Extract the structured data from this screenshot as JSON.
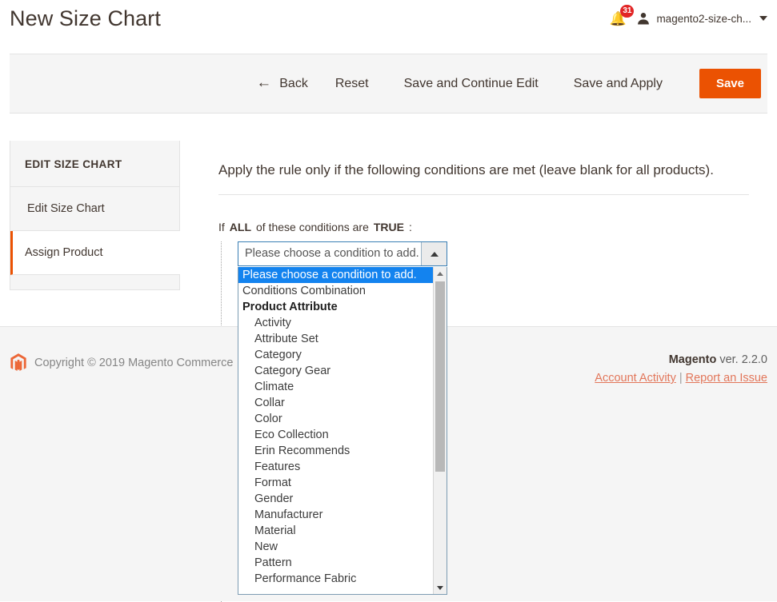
{
  "header": {
    "title": "New Size Chart",
    "notifications_count": "31",
    "bell_icon": "bell-icon",
    "user_icon": "user-avatar-icon",
    "user_name": "magento2-size-ch...",
    "caret_icon": "chevron-down-icon"
  },
  "toolbar": {
    "back_icon": "arrow-left-icon",
    "back_label": "Back",
    "reset_label": "Reset",
    "save_continue_label": "Save and Continue Edit",
    "save_apply_label": "Save and Apply",
    "save_label": "Save",
    "accent_color": "#eb5202"
  },
  "sidebar": {
    "title": "EDIT SIZE CHART",
    "items": [
      {
        "label": "Edit Size Chart",
        "current": false
      },
      {
        "label": "Assign Product",
        "current": true
      }
    ]
  },
  "content": {
    "note": "Apply the rule only if the following conditions are met (leave blank for all products).",
    "rule_prefix": "If",
    "rule_aggregator": "ALL",
    "rule_middle": "of these conditions are",
    "rule_value": "TRUE",
    "rule_suffix": ":"
  },
  "condition_select": {
    "selected_label": "Please choose a condition to add.",
    "toggle_icon": "triangle-up-icon",
    "scroll_up_icon": "scroll-up-arrow-icon",
    "scroll_down_icon": "scroll-down-arrow-icon",
    "options": [
      {
        "label": "Please choose a condition to add.",
        "type": "option",
        "selected": true
      },
      {
        "label": "Conditions Combination",
        "type": "option",
        "selected": false
      },
      {
        "label": "Product Attribute",
        "type": "group",
        "selected": false
      },
      {
        "label": "Activity",
        "type": "child",
        "selected": false
      },
      {
        "label": "Attribute Set",
        "type": "child",
        "selected": false
      },
      {
        "label": "Category",
        "type": "child",
        "selected": false
      },
      {
        "label": "Category Gear",
        "type": "child",
        "selected": false
      },
      {
        "label": "Climate",
        "type": "child",
        "selected": false
      },
      {
        "label": "Collar",
        "type": "child",
        "selected": false
      },
      {
        "label": "Color",
        "type": "child",
        "selected": false
      },
      {
        "label": "Eco Collection",
        "type": "child",
        "selected": false
      },
      {
        "label": "Erin Recommends",
        "type": "child",
        "selected": false
      },
      {
        "label": "Features",
        "type": "child",
        "selected": false
      },
      {
        "label": "Format",
        "type": "child",
        "selected": false
      },
      {
        "label": "Gender",
        "type": "child",
        "selected": false
      },
      {
        "label": "Manufacturer",
        "type": "child",
        "selected": false
      },
      {
        "label": "Material",
        "type": "child",
        "selected": false
      },
      {
        "label": "New",
        "type": "child",
        "selected": false
      },
      {
        "label": "Pattern",
        "type": "child",
        "selected": false
      },
      {
        "label": "Performance Fabric",
        "type": "child",
        "selected": false
      }
    ]
  },
  "footer": {
    "logo_icon": "magento-logo-icon",
    "copyright": "Copyright © 2019 Magento Commerce",
    "brand": "Magento",
    "version": "ver. 2.2.0",
    "account_activity_label": "Account Activity",
    "separator": "|",
    "report_issue_label": "Report an Issue"
  }
}
